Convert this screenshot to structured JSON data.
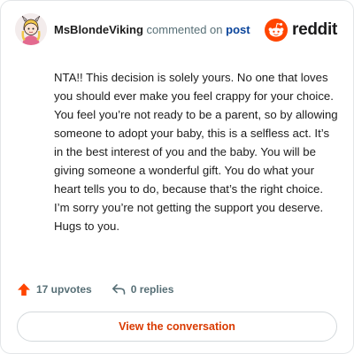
{
  "comment": {
    "author": "MsBlondeViking",
    "commented_on_text": "commented on",
    "post_link_text": "post",
    "body": "NTA!! This decision is solely yours. No one that loves you should ever make you feel crappy for your choice. You feel you’re not ready to be a parent, so by allowing someone to adopt your baby, this is a selfless act. It’s in the best interest of you and the baby. You will be giving someone a wonderful gift. You do what your heart tells you to do, because that’s the right choice. I’m sorry you’re not getting the support you deserve. Hugs to you."
  },
  "brand": {
    "logo_text": "reddit",
    "color": "#ff4500"
  },
  "actions": {
    "upvotes_label": "17 upvotes",
    "replies_label": "0 replies",
    "upvote_color": "#ff4500"
  },
  "cta": {
    "label": "View the conversation",
    "color": "#d93a00"
  },
  "icons": {
    "avatar": "avatar",
    "brand": "reddit-snoo-icon",
    "upvote": "upvote-arrow-icon",
    "reply": "reply-arrow-icon"
  }
}
